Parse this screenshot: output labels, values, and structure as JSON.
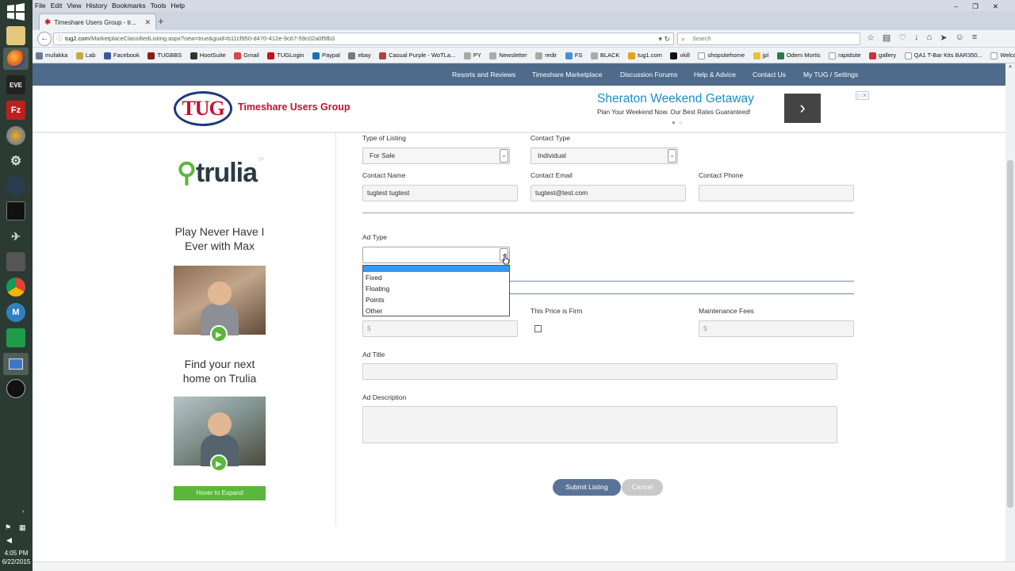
{
  "taskbar": {
    "icons": [
      "file-explorer-icon",
      "firefox-icon",
      "eve-icon",
      "filezilla-icon",
      "blender-icon",
      "settings-icon",
      "steam-icon",
      "terminal-icon",
      "jet-icon",
      "tank-icon",
      "chrome-icon",
      "m-app-icon",
      "calculator-icon",
      "remote-desktop-icon",
      "obs-icon"
    ],
    "eve_label": "EVE",
    "fz_label": "Fz",
    "m_label": "M",
    "clock_time": "4:05 PM",
    "clock_date": "6/22/2015"
  },
  "browser": {
    "menu": [
      "File",
      "Edit",
      "View",
      "History",
      "Bookmarks",
      "Tools",
      "Help"
    ],
    "tab_title": "Timeshare Users Group - tr...",
    "url_host": "tug2.com",
    "url_path": "/MarketplaceClassifiedListing.aspx?new=true&guid=b11cf950-d470-412e-9c67-59c02a0f5fb3",
    "search_placeholder": "Search",
    "bookmarks": [
      "mufakka",
      "Lab",
      "Facebook",
      "TUGBBS",
      "HootSuite",
      "Gmail",
      "TUGLogin",
      "Paypal",
      "ebay",
      "Casual Purple - WoTLa...",
      "PY",
      "Newsletter",
      "redir",
      "FS",
      "BLACK",
      "tug1.com",
      "vkill",
      "shopsitehome",
      "jpl",
      "Odem Mortis",
      "rapidsite",
      "gallery",
      "QA1 T-Bar Kits BAR350...",
      "Welcome To EFTPS - E..."
    ]
  },
  "site": {
    "nav": [
      "Resorts and Reviews",
      "Timeshare Marketplace",
      "Discussion Forums",
      "Help & Advice",
      "Contact Us",
      "My TUG / Settings"
    ],
    "logo_text": "TUG",
    "name": "Timeshare Users Group",
    "banner": {
      "title": "Sheraton Weekend Getaway",
      "subtitle": "Plan Your Weekend Now. Our Best Rates Guaranteed!",
      "arrow": "›",
      "dots": "●○",
      "adchoices": "▷✕"
    }
  },
  "side_ad": {
    "logo": "trulia",
    "adchoices": "▷",
    "headline1": "Play Never Have I Ever with Max",
    "headline2": "Find your next home on Trulia",
    "cta": "Hover to Expand",
    "play": "▶"
  },
  "form": {
    "type_of_listing_label": "Type of Listing",
    "type_of_listing_value": "For Sale",
    "contact_type_label": "Contact Type",
    "contact_type_value": "Individual",
    "contact_name_label": "Contact Name",
    "contact_name_value": "tugtest tugtest",
    "contact_email_label": "Contact Email",
    "contact_email_value": "tugtest@test.com",
    "contact_phone_label": "Contact Phone",
    "contact_phone_value": "",
    "ad_type_label": "Ad Type",
    "ad_type_value": "",
    "ad_type_options": [
      "",
      "Fixed",
      "Floating",
      "Points",
      "Other"
    ],
    "price_firm_label": "This Price is Firm",
    "price_placeholder": "$",
    "maintenance_label": "Maintenance Fees",
    "maintenance_placeholder": "$",
    "ad_title_label": "Ad Title",
    "ad_description_label": "Ad Description",
    "caret": "⌄",
    "submit_label": "Submit Listing",
    "cancel_label": "Cancel"
  },
  "colors": {
    "nav_bg": "#4f6b8c",
    "brand_red": "#c8102e",
    "submit_bg": "#5a7497",
    "dropdown_highlight": "#3399ff"
  }
}
